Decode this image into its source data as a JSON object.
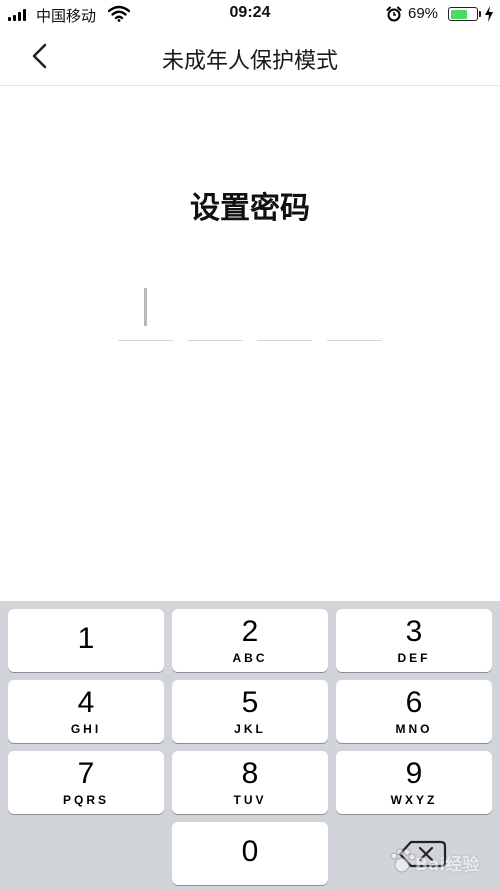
{
  "status_bar": {
    "carrier": "中国移动",
    "time": "09:24",
    "battery_percent": "69%",
    "battery_level": 0.69,
    "icons": [
      "signal-icon",
      "wifi-icon",
      "alarm-icon",
      "battery-icon",
      "charging-icon"
    ]
  },
  "nav": {
    "back_icon": "chevron-left-icon",
    "title": "未成年人保护模式"
  },
  "content": {
    "heading": "设置密码",
    "pin_length": 4,
    "pin_value": ""
  },
  "keypad": {
    "keys": [
      {
        "digit": "1",
        "letters": ""
      },
      {
        "digit": "2",
        "letters": "ABC"
      },
      {
        "digit": "3",
        "letters": "DEF"
      },
      {
        "digit": "4",
        "letters": "GHI"
      },
      {
        "digit": "5",
        "letters": "JKL"
      },
      {
        "digit": "6",
        "letters": "MNO"
      },
      {
        "digit": "7",
        "letters": "PQRS"
      },
      {
        "digit": "8",
        "letters": "TUV"
      },
      {
        "digit": "9",
        "letters": "WXYZ"
      },
      {
        "digit": "0",
        "letters": ""
      }
    ],
    "delete_icon": "backspace-icon"
  },
  "watermark": {
    "text": "Bai经验"
  },
  "colors": {
    "keypad_background": "#d1d4d9",
    "key_background": "#ffffff",
    "battery_fill": "#4cd964"
  }
}
